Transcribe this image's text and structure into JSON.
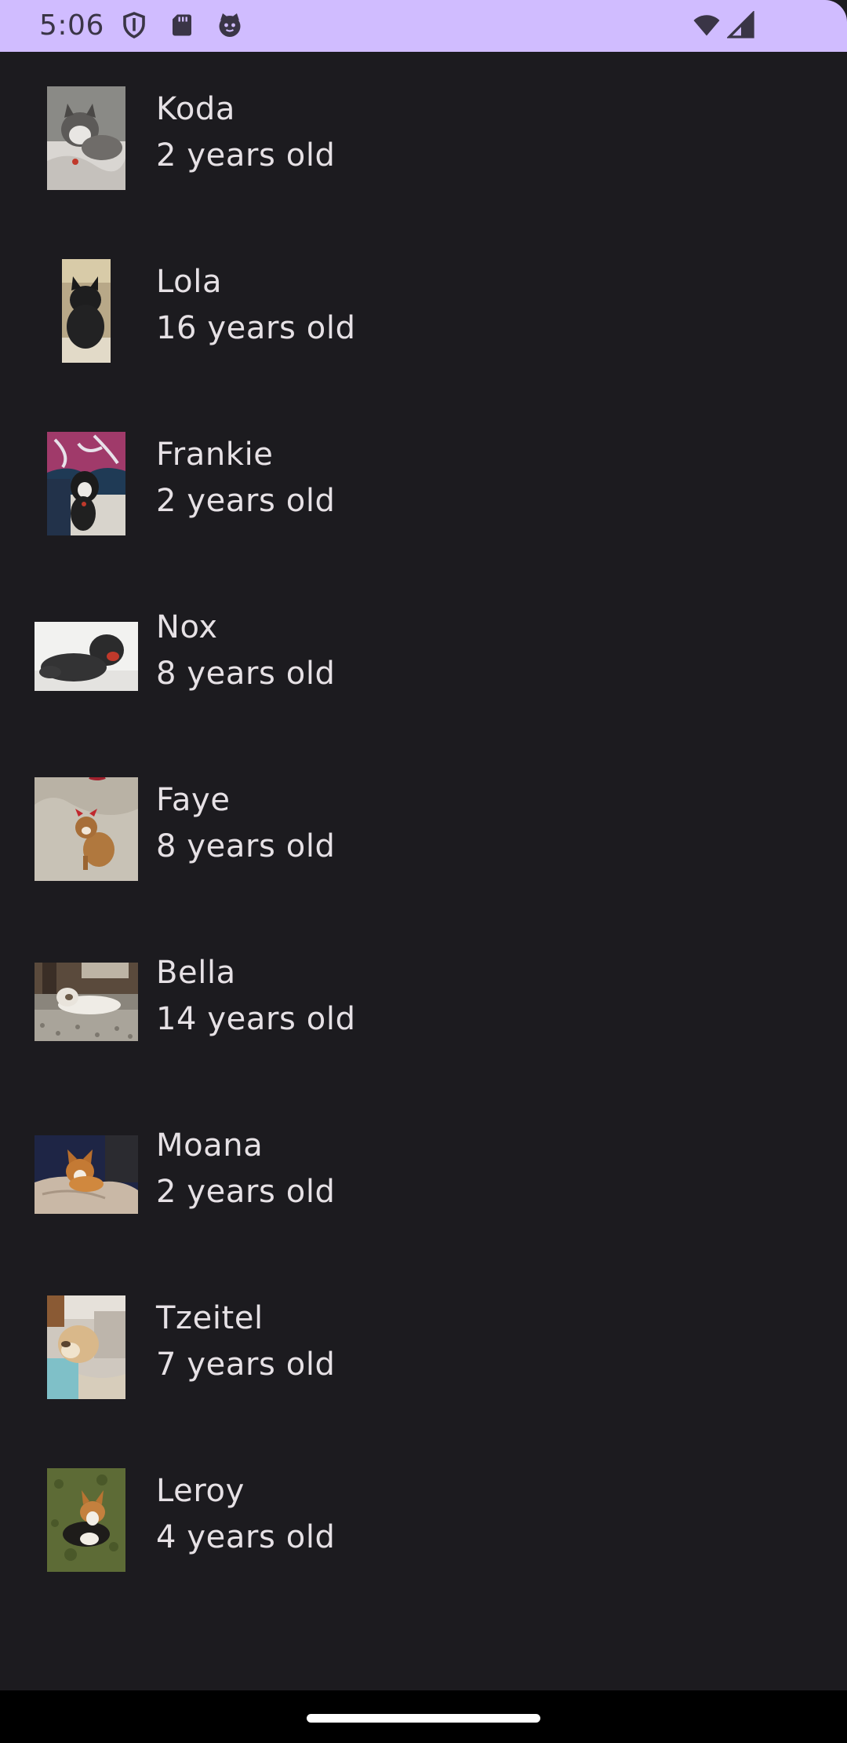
{
  "status_bar": {
    "time": "5:06",
    "background": "#d0bcff",
    "icons": [
      "shield-icon",
      "sd-card-icon",
      "cat-face-icon",
      "wifi-icon",
      "cell-signal-icon"
    ]
  },
  "dogs": [
    {
      "name": "Koda",
      "age": "2 years old",
      "photo": "husky-puppy-photo"
    },
    {
      "name": "Lola",
      "age": "16 years old",
      "photo": "black-dog-photo"
    },
    {
      "name": "Frankie",
      "age": "2 years old",
      "photo": "dog-on-patterned-blanket-photo"
    },
    {
      "name": "Nox",
      "age": "8 years old",
      "photo": "black-fluffy-dog-photo"
    },
    {
      "name": "Faye",
      "age": "8 years old",
      "photo": "small-dog-with-bow-photo"
    },
    {
      "name": "Bella",
      "age": "14 years old",
      "photo": "dog-lying-on-gravel-photo"
    },
    {
      "name": "Moana",
      "age": "2 years old",
      "photo": "corgi-on-blanket-photo"
    },
    {
      "name": "Tzeitel",
      "age": "7 years old",
      "photo": "sleeping-dog-photo"
    },
    {
      "name": "Leroy",
      "age": "4 years old",
      "photo": "corgi-on-grass-photo"
    }
  ],
  "colors": {
    "background": "#1c1b1f",
    "text": "#e6e1e5",
    "nav_bar": "#000000"
  }
}
